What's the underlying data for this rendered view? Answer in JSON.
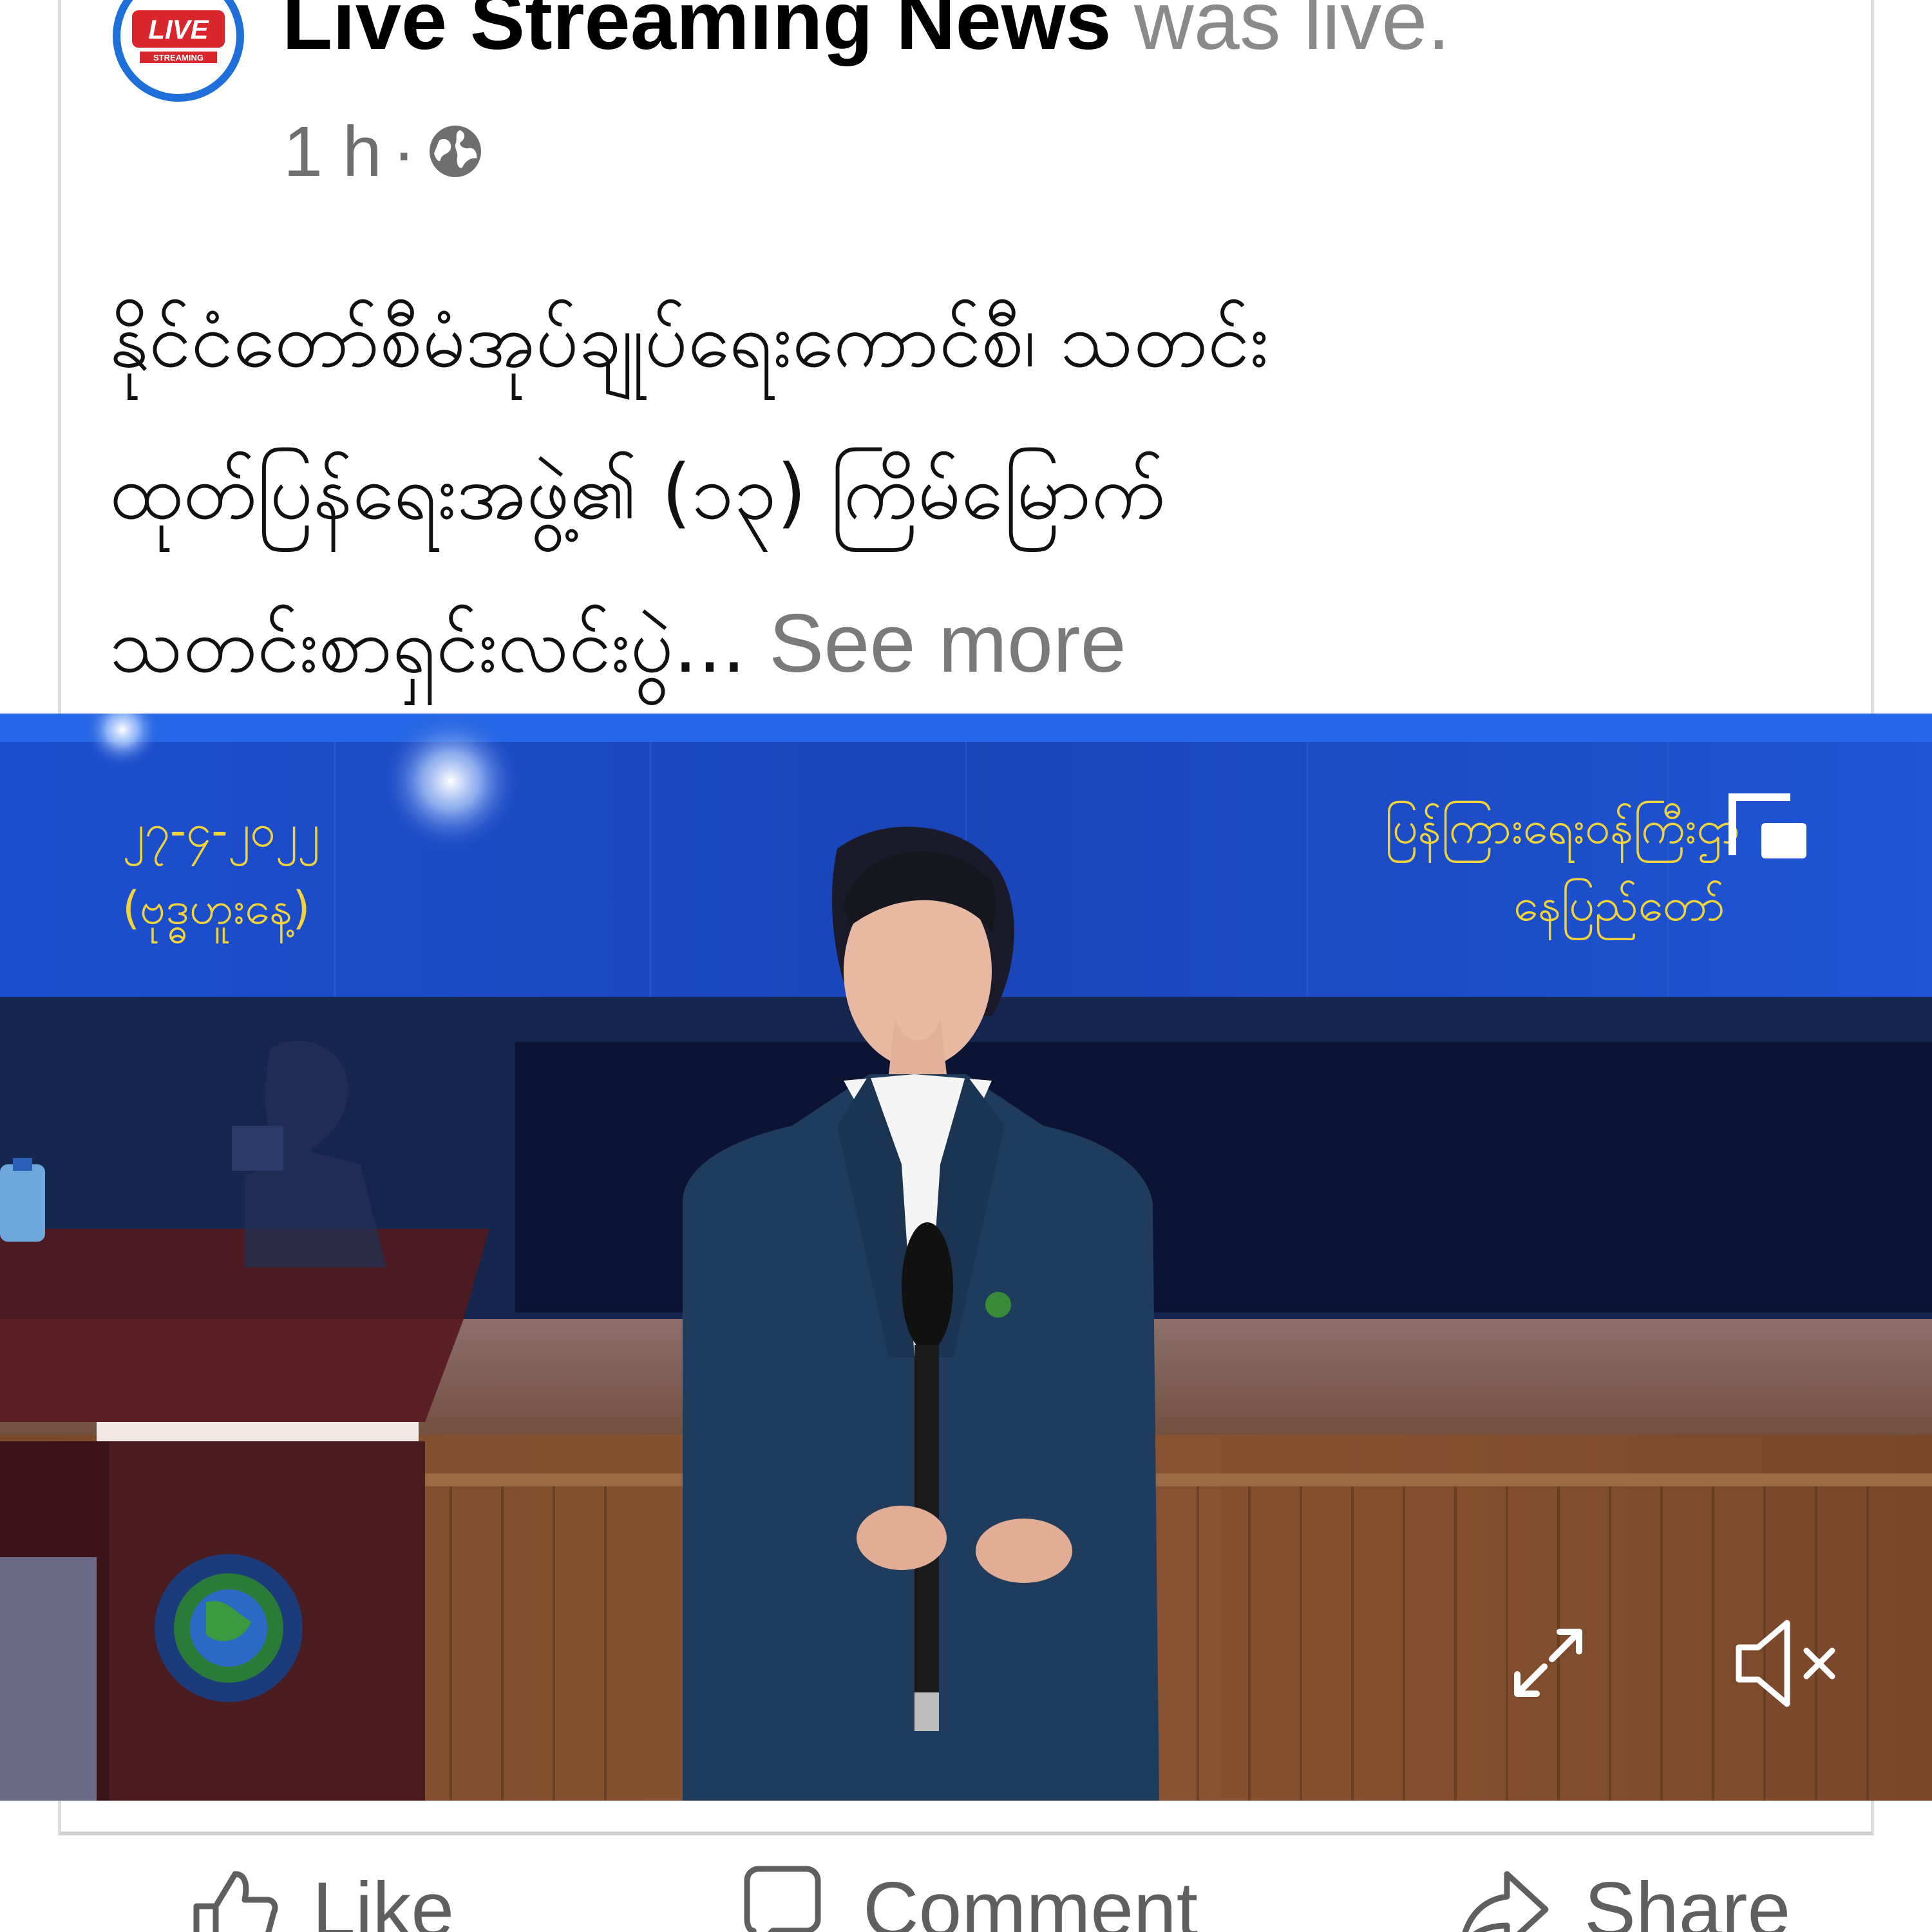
{
  "post": {
    "page_name": "Live Streaming News",
    "status": " was live.",
    "time": "1 h",
    "separator": "·",
    "avatar_label": "LIVE",
    "avatar_sub": "STREAMING",
    "text_lines": [
      "နိုင်ငံတော်စီမံအုပ်ချုပ်ရေးကောင်စီ၊ သတင်း",
      "ထုတ်ပြန်ရေးအဖွဲ့၏ (၁၃) ကြိမ်မြောက်",
      "သတင်းစာရှင်းလင်းပွဲ..."
    ],
    "see_more": " See more"
  },
  "video": {
    "date_line": "၂၇-၄-၂၀၂၂",
    "day_line": "(ဗုဒ္ဓဟူးနေ့)",
    "location_line1": "ပြန်ကြားရေးဝန်ကြီးဌာ",
    "location_line2": "နေပြည်တော်"
  },
  "actions": {
    "like": "Like",
    "comment": "Comment",
    "share": "Share"
  },
  "icons": [
    "globe-icon",
    "pip-icon",
    "fullscreen-icon",
    "mute-icon",
    "like-icon",
    "comment-icon",
    "share-icon"
  ],
  "colors": {
    "accent": "#1e6fd9",
    "overlay_text": "#f2d43a"
  }
}
